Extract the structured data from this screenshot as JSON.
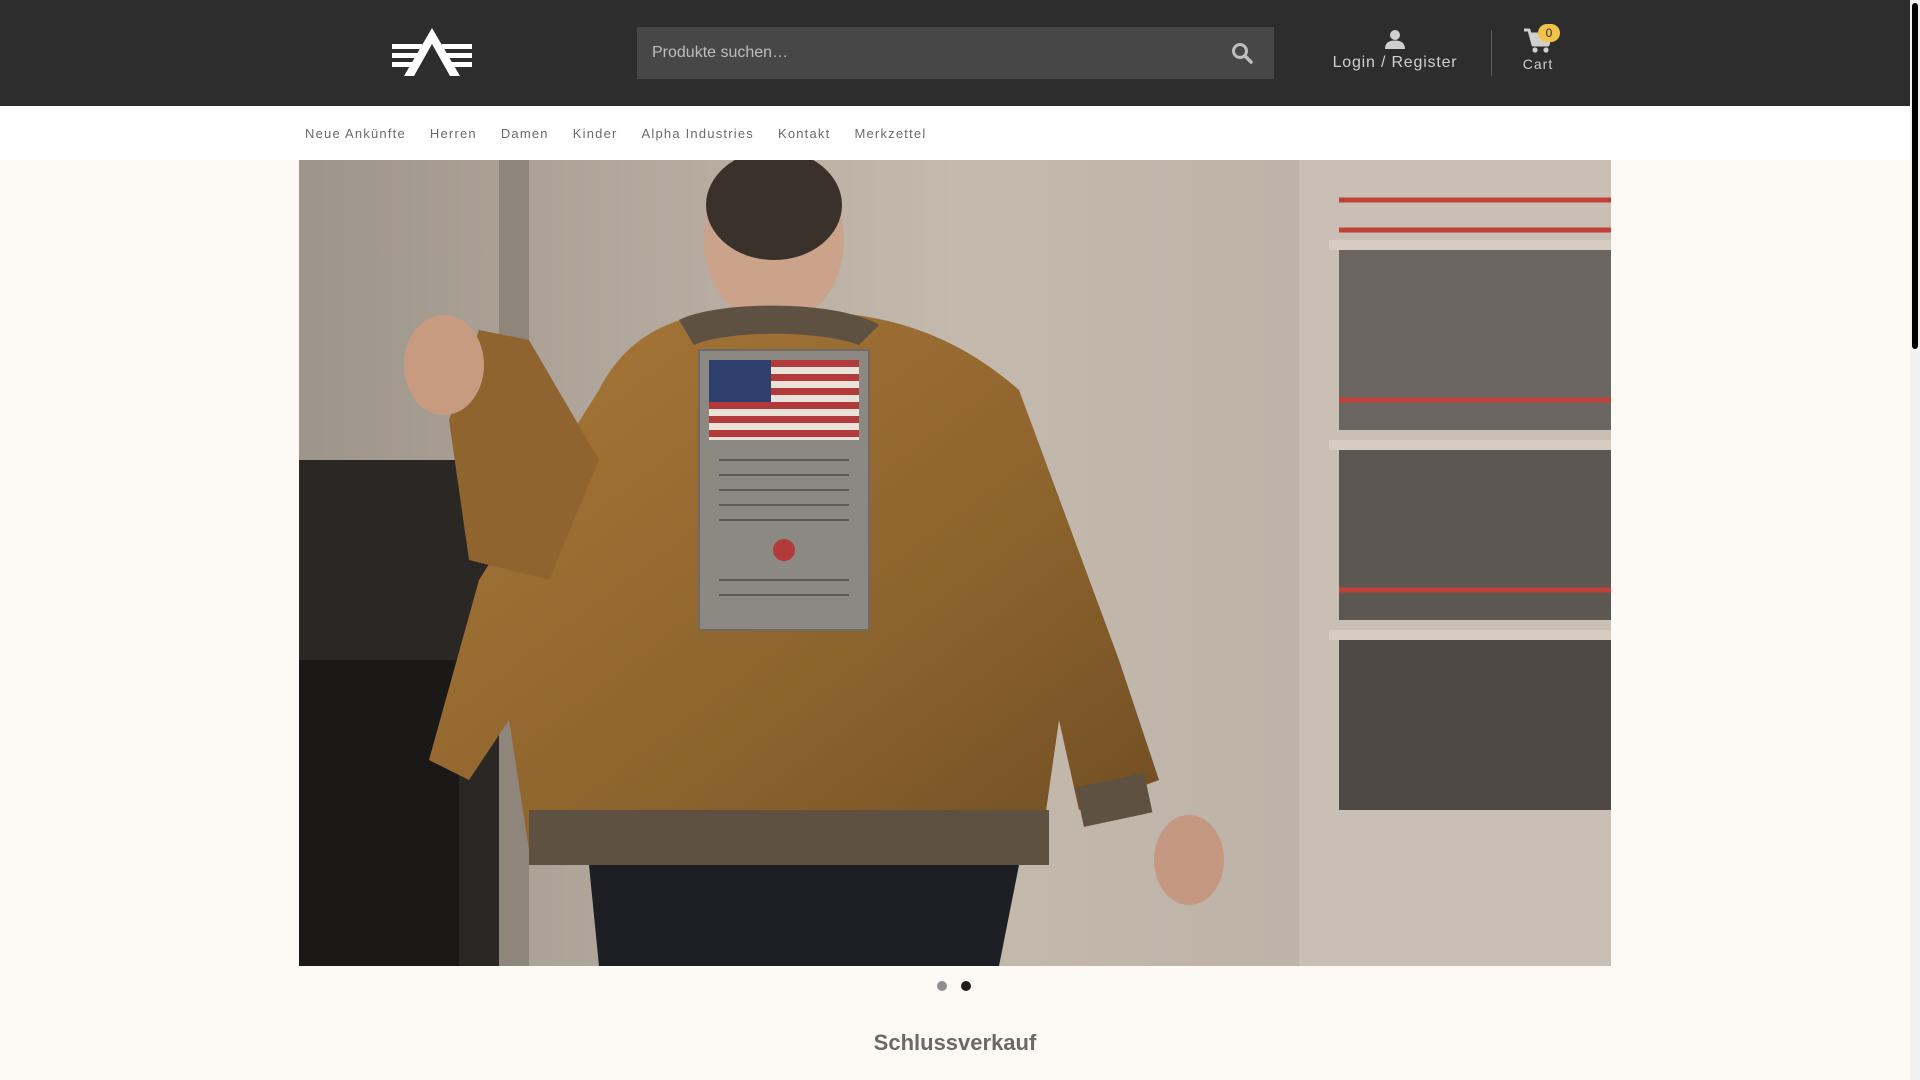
{
  "header": {
    "logo_icon": "alpha-industries-logo",
    "search": {
      "placeholder": "Produkte suchen…",
      "value": "",
      "button_icon": "search-icon"
    },
    "account": {
      "icon": "user-icon",
      "label": "Login / Register"
    },
    "cart": {
      "icon": "shopping-cart-icon",
      "label": "Cart",
      "count": "0"
    }
  },
  "nav": {
    "items": [
      {
        "label": "Neue Ankünfte"
      },
      {
        "label": "Herren"
      },
      {
        "label": "Damen"
      },
      {
        "label": "Kinder"
      },
      {
        "label": "Alpha Industries"
      },
      {
        "label": "Kontakt"
      },
      {
        "label": "Merkzettel"
      }
    ]
  },
  "hero": {
    "slide_count": 2,
    "active_slide": 2
  },
  "section": {
    "title": "Schlussverkauf"
  },
  "colors": {
    "header_bg": "#2d2d2d",
    "page_bg": "#fdf9f5",
    "badge": "#f2c24a",
    "jacket": "#9a6d32",
    "concrete": "#bdb2a6",
    "railing": "#c0413a"
  }
}
